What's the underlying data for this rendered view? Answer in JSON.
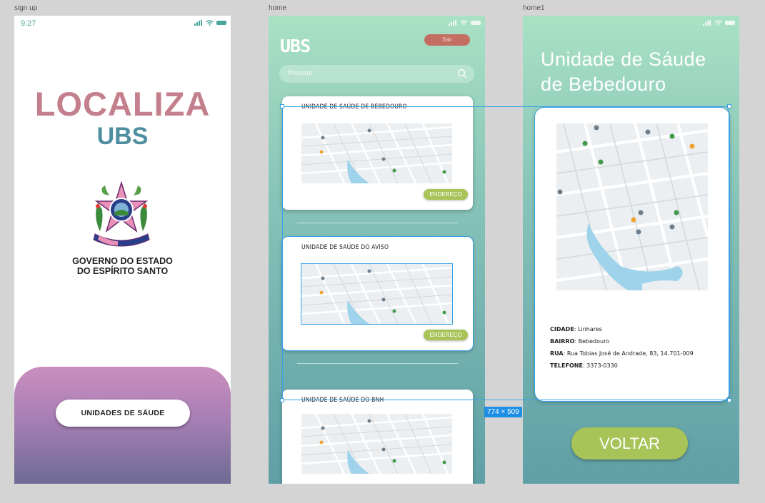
{
  "frames": {
    "signup_label": "sign up",
    "home_label": "home",
    "home1_label": "home1"
  },
  "signup": {
    "time": "9:27",
    "title": "LOCALIZA",
    "subtitle": "UBS",
    "gov_line1": "GOVERNO DO ESTADO",
    "gov_line2": "DO ESPÍRITO SANTO",
    "button_label": "UNIDADES DE SÁUDE"
  },
  "home": {
    "title": "UBS",
    "sair_label": "Sair",
    "search_placeholder": "Procurar",
    "cards": [
      {
        "name": "UNIDADE DE SAÚDE DE BEBEDOURO",
        "button": "ENDEREÇO"
      },
      {
        "name": "UNIDADE DE SAÚDE DO AVISO",
        "button": "ENDEREÇO"
      },
      {
        "name": "UNIDADE DE SAÚDE DO BNH"
      }
    ]
  },
  "home1": {
    "title_line1": "Unidade de Sáude",
    "title_line2": "de Bebedouro",
    "cidade_label": "CIDADE",
    "cidade_value": "Linhares",
    "bairro_label": "BAIRRO",
    "bairro_value": "Bebedouro",
    "rua_label": "RUA",
    "rua_value": "Rua Tobias José de Andrade, 83, 14.701-009",
    "telefone_label": "TELEFONE",
    "telefone_value": "3373-0330",
    "voltar_label": "VOLTAR"
  },
  "selection": {
    "dimensions": "774 × 509"
  },
  "colors": {
    "localiza": "#c47f8c",
    "ubs_blue": "#4d8ea0",
    "green_button": "#a8c357",
    "sair_red": "#c46e61",
    "selection_blue": "#1e8fe6"
  }
}
